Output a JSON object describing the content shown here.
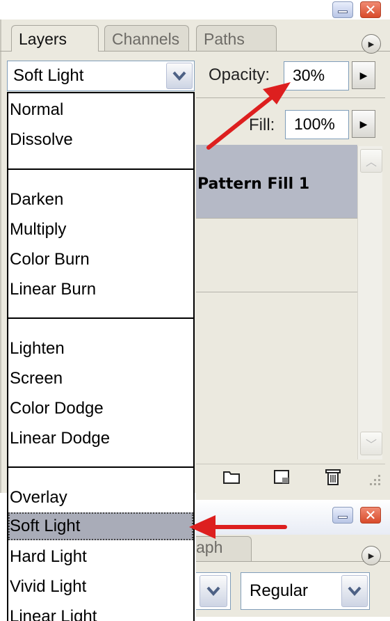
{
  "top_window": {
    "minimize_icon": "minimize-icon",
    "close_icon": "close-icon"
  },
  "layers_panel": {
    "tabs": [
      {
        "label": "Layers",
        "active": true
      },
      {
        "label": "Channels",
        "active": false
      },
      {
        "label": "Paths",
        "active": false
      }
    ],
    "blend_mode": {
      "value": "Soft Light"
    },
    "opacity": {
      "label": "Opacity:",
      "value": "30%"
    },
    "fill": {
      "label": "Fill:",
      "value": "100%"
    },
    "layers": [
      {
        "name": "Pattern Fill 1",
        "selected": true
      },
      {
        "name": "",
        "selected": false
      },
      {
        "name": "",
        "selected": false
      }
    ],
    "toolbar_icons": [
      "new-group-icon",
      "new-layer-icon",
      "trash-icon"
    ]
  },
  "blend_dropdown": {
    "groups": [
      [
        "Normal",
        "Dissolve"
      ],
      [
        "Darken",
        "Multiply",
        "Color Burn",
        "Linear Burn"
      ],
      [
        "Lighten",
        "Screen",
        "Color Dodge",
        "Linear Dodge"
      ],
      [
        "Overlay",
        "Soft Light",
        "Hard Light",
        "Vivid Light",
        "Linear Light"
      ]
    ],
    "selected": "Soft Light"
  },
  "lower_panel": {
    "tab_partial": "aph",
    "font_style": {
      "value": "Regular"
    }
  },
  "colors": {
    "panel": "#ebe9df",
    "selected_layer": "#b5b9c6",
    "selected_item": "#a9acb8",
    "annotation_arrow": "#dd1f1f",
    "close_button": "#d84a2a"
  }
}
